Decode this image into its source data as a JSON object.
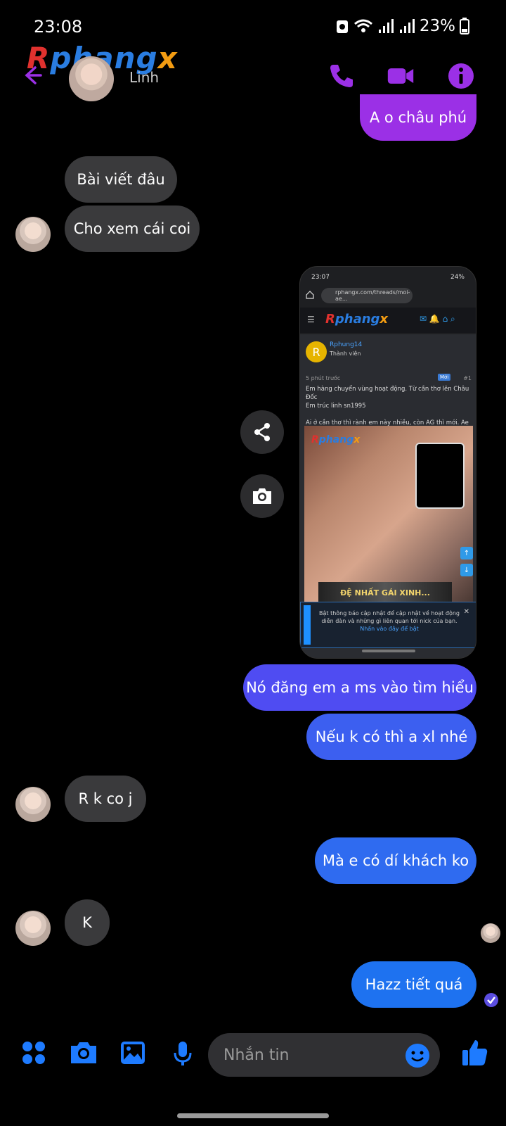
{
  "status_bar": {
    "time": "23:08",
    "battery": "23%"
  },
  "header": {
    "contact_name": "Linh",
    "logo_text": "Rphangx"
  },
  "colors": {
    "accent_purple": "#9b30e6",
    "out_blue": "#2f6bf0",
    "out_indigo": "#4f4cf2",
    "in_gray": "#3a3a3c",
    "icon_blue": "#1e7bff"
  },
  "messages": {
    "m1": "A o châu phú",
    "m2": "Bài viết đâu",
    "m3": "Cho xem cái coi",
    "m4": "Nó đăng em a ms vào tìm hiểu",
    "m5": "Nếu k có thì a xl nhé",
    "m6": "R k co j",
    "m7": "Mà e có dí khách ko",
    "m8": "K",
    "m9": "Hazz tiết quá"
  },
  "attachment": {
    "status_time": "23:07",
    "status_battery": "24%",
    "url": "rphangx.com/threads/moi-ae...",
    "site_logo": "Rphangx",
    "username": "Rphung14",
    "user_role": "Thành viên",
    "post_time": "5 phút trước",
    "new_badge": "Mới",
    "post_number": "#1",
    "post_text_1": "Em hàng chuyển vùng hoạt động. Từ cần thơ lên Châu Đốc",
    "post_text_2": "Em trúc linh sn1995",
    "post_text_3": "Ai ở cần thơ thì rành em này nhiều, còn AG thì mới. Ae check dần nhá",
    "image_watermark": "Rphangx",
    "banner_text": "ĐỆ NHẤT GÁI XINH...",
    "notice_text": "Bật thông báo cập nhật để cập nhật về hoạt động diễn đàn và những gì liên quan tới nick của bạn.",
    "notice_link": "Nhấn vào đây để bật",
    "notice_close": "✕",
    "arrow_up": "↑",
    "arrow_down": "↓"
  },
  "composer": {
    "placeholder": "Nhắn tin"
  }
}
